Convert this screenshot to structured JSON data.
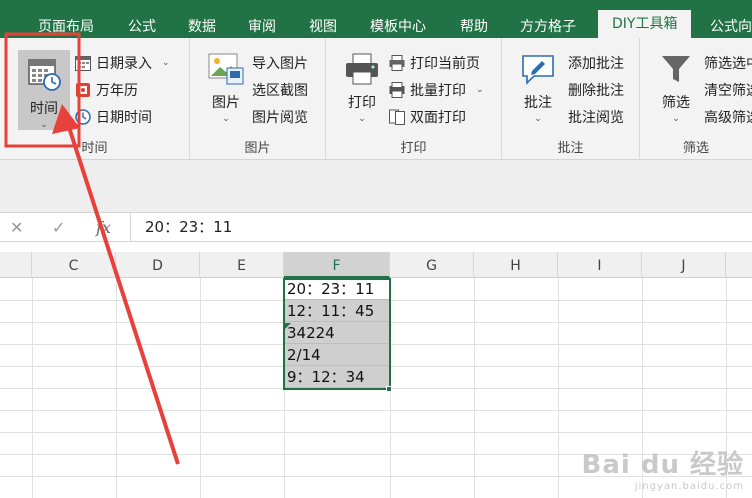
{
  "tabs": [
    {
      "label": "页面布局"
    },
    {
      "label": "公式"
    },
    {
      "label": "数据"
    },
    {
      "label": "审阅"
    },
    {
      "label": "视图"
    },
    {
      "label": "模板中心"
    },
    {
      "label": "帮助"
    },
    {
      "label": "方方格子"
    },
    {
      "label": "DIY工具箱",
      "active": true
    },
    {
      "label": "公式向"
    }
  ],
  "ribbon": {
    "time_group": {
      "big_button": "时间",
      "items": [
        "日期录入",
        "万年历",
        "日期时间"
      ],
      "label": "时间"
    },
    "picture_group": {
      "big_button": "图片",
      "items": [
        "导入图片",
        "选区截图",
        "图片阅览"
      ],
      "label": "图片"
    },
    "print_group": {
      "big_button": "打印",
      "items": [
        "打印当前页",
        "批量打印",
        "双面打印"
      ],
      "label": "打印"
    },
    "comment_group": {
      "big_button": "批注",
      "items": [
        "添加批注",
        "删除批注",
        "批注阅览"
      ],
      "label": "批注"
    },
    "filter_group": {
      "big_button": "筛选",
      "items": [
        "筛选选中",
        "清空筛选",
        "高级筛选"
      ],
      "label": "筛选"
    }
  },
  "formula_bar": {
    "cancel": "✕",
    "confirm": "✓",
    "fx": "fx",
    "value": "20：23：11"
  },
  "columns": [
    "C",
    "D",
    "E",
    "F",
    "G",
    "H",
    "I",
    "J"
  ],
  "selected_column": "F",
  "cells": [
    "20：23：11",
    "12：11：45",
    "34224",
    "2/14",
    "9：12：34"
  ],
  "watermark": {
    "main": "Bai du 经验",
    "sub": "jingyan.baidu.com"
  },
  "colors": {
    "accent": "#217346",
    "annotation": "#e8403a"
  }
}
